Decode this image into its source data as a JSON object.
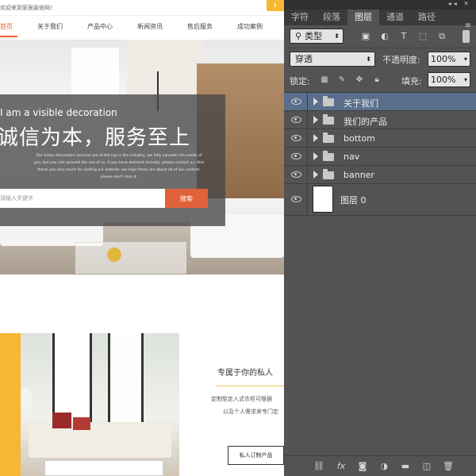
{
  "website": {
    "welcome_text": "欢迎来到家居装修网!",
    "nav": [
      "首页",
      "关于我们",
      "产品中心",
      "新闻资讯",
      "售后服务",
      "成功案例"
    ],
    "banner": {
      "subtitle": "I am a visible decoration",
      "title": "诚信为本，服务至上",
      "description": "Our home decoration services are at the top in the industry, we fully consider the needs of you, but you rest assured the use of us. If you have demand recently, please contact us. Also thank you very much for visiting our website, we hope these are about all of our content, please don't miss it.",
      "search_placeholder": "请输入关键字",
      "search_button": "搜索"
    },
    "card": {
      "title": "专属于你的私人",
      "text1": "定制型走入式衣柜可根据",
      "text2": "以及个人需求来专门定",
      "button": "私人订制产品"
    },
    "accent_color": "#f7b633",
    "highlight_color": "#e8622e"
  },
  "photoshop": {
    "tabs": [
      "字符",
      "段落",
      "图层",
      "通道",
      "路径"
    ],
    "active_tab": "图层",
    "filter": {
      "kind_label": "类型",
      "icons": [
        "image-filter-icon",
        "adjustment-filter-icon",
        "type-filter-icon",
        "shape-filter-icon",
        "smart-object-filter-icon"
      ]
    },
    "blend_mode": "穿透",
    "opacity_label": "不透明度:",
    "opacity_value": "100%",
    "lock_label": "锁定:",
    "fill_label": "填充:",
    "fill_value": "100%",
    "layers": [
      {
        "name": "关于我们",
        "type": "group",
        "selected": true
      },
      {
        "name": "我们的产品",
        "type": "group",
        "selected": false
      },
      {
        "name": "bottom",
        "type": "group",
        "selected": false
      },
      {
        "name": "nav",
        "type": "group",
        "selected": false
      },
      {
        "name": "banner",
        "type": "group",
        "selected": false
      },
      {
        "name": "图层 0",
        "type": "layer",
        "selected": false
      }
    ],
    "footer_icons": [
      "link-layers-icon",
      "fx-icon",
      "add-mask-icon",
      "adjustment-layer-icon",
      "new-group-icon",
      "new-layer-icon",
      "trash-icon"
    ],
    "selected_color": "#5a6f8c"
  }
}
